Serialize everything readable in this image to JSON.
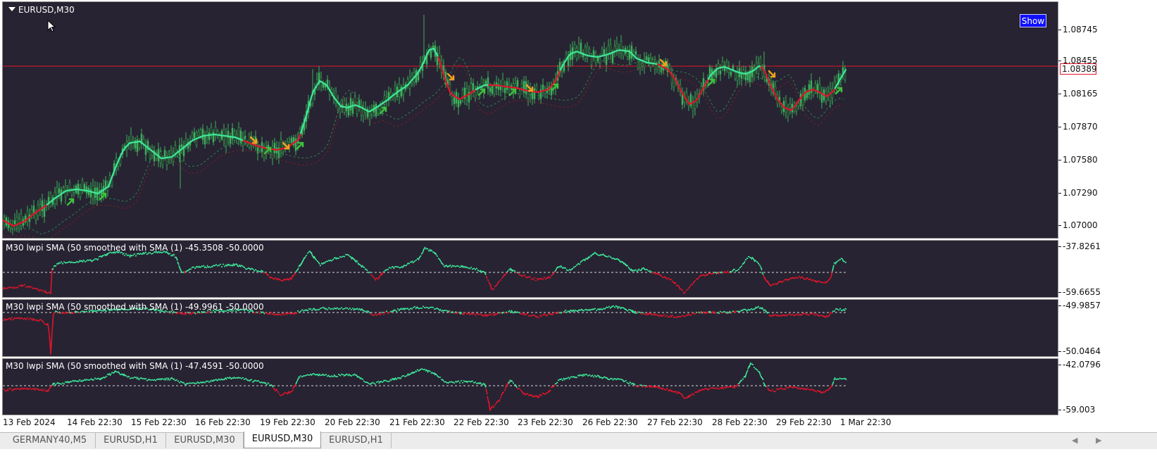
{
  "chart": {
    "symbol_title": "EURUSD,M30",
    "show_button": "Show",
    "current_price": "1.08389",
    "price_scale": [
      "1.08745",
      "1.08455",
      "1.08165",
      "1.07870",
      "1.07580",
      "1.07290",
      "1.07000"
    ],
    "colors": {
      "background": "#272332",
      "up_line": "#3ee89b",
      "down_line": "#e0152a",
      "candles": "#3bb05a",
      "buy_arrow": "#3ec23e",
      "sell_arrow": "#f0a01e",
      "price_line": "#e0152a"
    }
  },
  "indicators": [
    {
      "title": "M30 lwpi  SMA (50 smoothed with  SMA (1) -45.3508 -50.0000",
      "scale": [
        "-37.8261",
        "-59.6655"
      ]
    },
    {
      "title": "M30 lwpi  SMA (50 smoothed with  SMA (1) -49.9961 -50.0000",
      "scale": [
        "-49.9857",
        "-50.0464"
      ]
    },
    {
      "title": "M30 lwpi  SMA (50 smoothed with  SMA (1) -47.4591 -50.0000",
      "scale": [
        "-42.0796",
        "-59.003"
      ]
    }
  ],
  "time_axis": [
    "13 Feb 2024",
    "14 Feb 22:30",
    "15 Feb 22:30",
    "16 Feb 22:30",
    "19 Feb 22:30",
    "20 Feb 22:30",
    "21 Feb 22:30",
    "22 Feb 22:30",
    "23 Feb 22:30",
    "26 Feb 22:30",
    "27 Feb 22:30",
    "28 Feb 22:30",
    "29 Feb 22:30",
    "1 Mar 22:30"
  ],
  "tabs": [
    {
      "label": "GERMANY40,M5",
      "active": false
    },
    {
      "label": "EURUSD,H1",
      "active": false
    },
    {
      "label": "EURUSD,M30",
      "active": false
    },
    {
      "label": "EURUSD,M30",
      "active": true
    },
    {
      "label": "EURUSD,H1",
      "active": false
    }
  ],
  "icons": {
    "scroll_left": "arrow-left-icon",
    "scroll_right": "arrow-right-icon",
    "cursor": "mouse-pointer-icon"
  }
}
